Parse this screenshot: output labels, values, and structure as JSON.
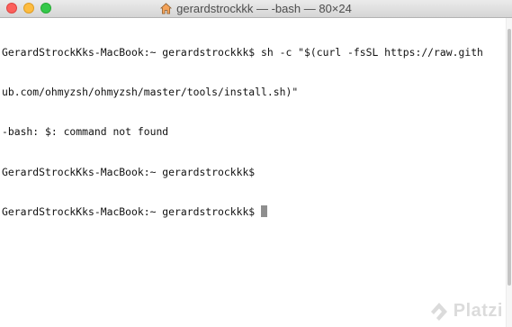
{
  "window": {
    "title": "gerardstrockkk — -bash — 80×24"
  },
  "terminal": {
    "lines": [
      "GerardStrockKks-MacBook:~ gerardstrockkk$ sh -c \"$(curl -fsSL https://raw.gith",
      "ub.com/ohmyzsh/ohmyzsh/master/tools/install.sh)\"",
      "-bash: $: command not found",
      "GerardStrockKks-MacBook:~ gerardstrockkk$ ",
      "GerardStrockKks-MacBook:~ gerardstrockkk$ "
    ]
  },
  "watermark": {
    "text": "Platzi"
  },
  "icons": {
    "title_icon": "home-icon",
    "watermark_icon": "platzi-logo-icon"
  },
  "colors": {
    "close": "#fc605c",
    "minimize": "#fdbc40",
    "zoom": "#34c84a",
    "cursor": "#8e8e8e"
  }
}
